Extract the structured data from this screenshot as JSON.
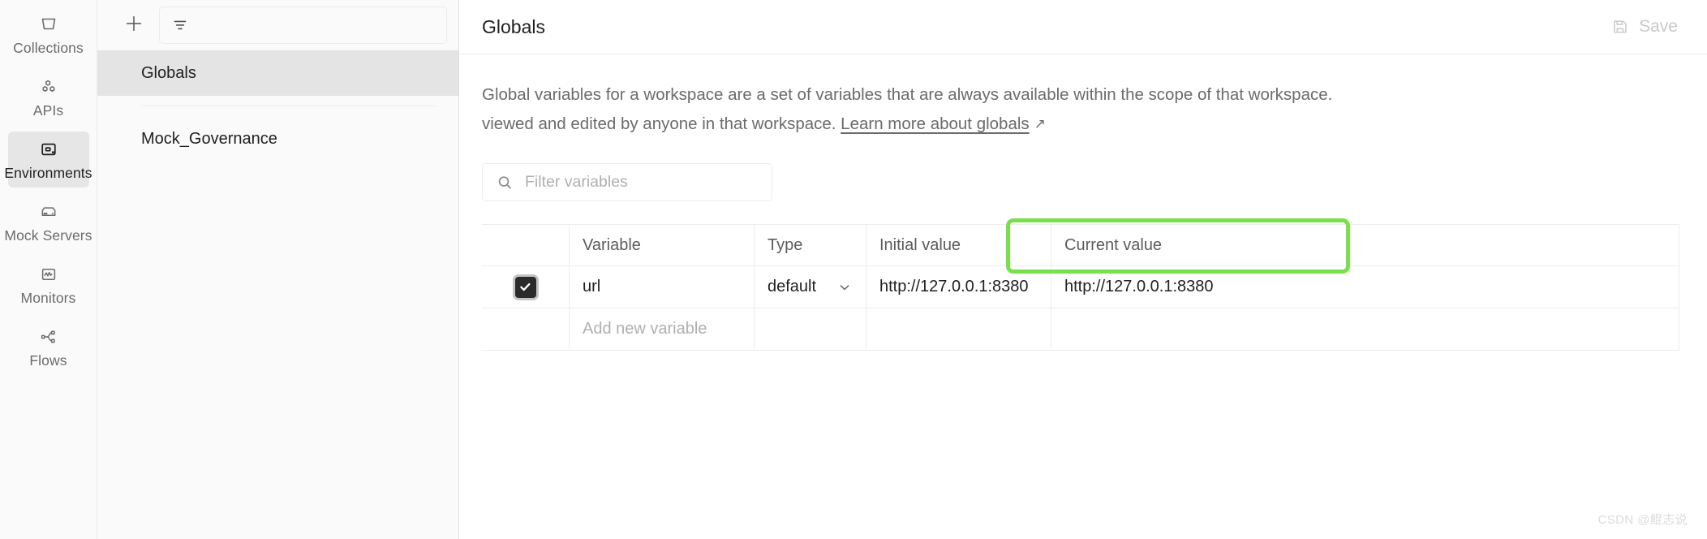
{
  "rail": {
    "items": [
      {
        "label": "Collections",
        "icon": "collections-icon",
        "active": false
      },
      {
        "label": "APIs",
        "icon": "apis-icon",
        "active": false
      },
      {
        "label": "Environments",
        "icon": "environments-icon",
        "active": true
      },
      {
        "label": "Mock Servers",
        "icon": "mock-servers-icon",
        "active": false
      },
      {
        "label": "Monitors",
        "icon": "monitors-icon",
        "active": false
      },
      {
        "label": "Flows",
        "icon": "flows-icon",
        "active": false
      }
    ]
  },
  "list_pane": {
    "create_icon": "plus-icon",
    "filter_icon": "filter-icon",
    "filter_placeholder": "",
    "environments": [
      {
        "label": "Globals",
        "selected": true
      },
      {
        "label": "Mock_Governance",
        "selected": false
      }
    ]
  },
  "main": {
    "title": "Globals",
    "save_label": "Save",
    "save_icon": "save-disk-icon",
    "save_disabled": true,
    "description_part1": "Global variables for a workspace are a set of variables that are always available within the scope of that workspace.",
    "description_part2": "viewed and edited by anyone in that workspace. ",
    "description_link": "Learn more about globals",
    "description_link_icon": "external-link-arrow-icon",
    "search": {
      "icon": "search-icon",
      "placeholder": "Filter variables",
      "value": ""
    },
    "table": {
      "columns": [
        "",
        "Variable",
        "Type",
        "Initial value",
        "Current value"
      ],
      "rows": [
        {
          "checked": true,
          "variable": "url",
          "type": "default",
          "type_chevron": "chevron-down-icon",
          "initial_value": "http://127.0.0.1:8380",
          "current_value": "http://127.0.0.1:8380"
        }
      ],
      "add_row_placeholder": "Add new variable"
    },
    "highlight_color": "#7ae04a"
  },
  "watermark": "CSDN @鲲志说"
}
